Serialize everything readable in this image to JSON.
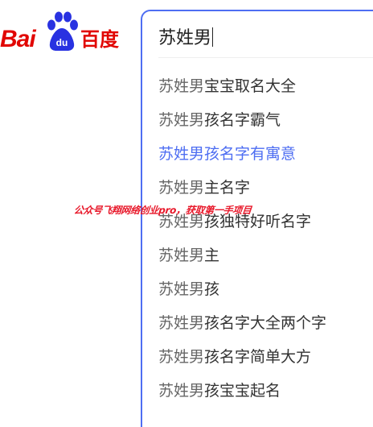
{
  "logo": {
    "latin": "Bai",
    "paw_text": "du",
    "chinese": "百度"
  },
  "search": {
    "value": "苏姓男"
  },
  "suggestions": [
    {
      "query": "苏姓男",
      "rest": "宝宝取名大全"
    },
    {
      "query": "苏姓男",
      "rest": "孩名字霸气"
    },
    {
      "query": "苏姓男",
      "rest": "孩名字有寓意"
    },
    {
      "query": "苏姓男",
      "rest": "主名字"
    },
    {
      "query": "苏姓男",
      "rest": "孩独特好听名字"
    },
    {
      "query": "苏姓男",
      "rest": "主"
    },
    {
      "query": "苏姓男",
      "rest": "孩"
    },
    {
      "query": "苏姓男",
      "rest": "孩名字大全两个字"
    },
    {
      "query": "苏姓男",
      "rest": "孩名字简单大方"
    },
    {
      "query": "苏姓男",
      "rest": "孩宝宝起名"
    }
  ],
  "active_index": 2,
  "watermark": "公众号飞翔网络创业pro，获取第一手项目",
  "colors": {
    "brand_red": "#e10602",
    "brand_blue": "#2932e1",
    "accent_blue": "#4e6ef2",
    "watermark_red": "#e8182a"
  }
}
